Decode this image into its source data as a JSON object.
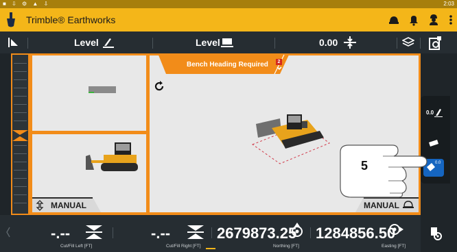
{
  "status_bar": {
    "time": "2:03",
    "icons": [
      "square-icon",
      "download-icon",
      "satellite-icon",
      "warning-icon",
      "download-icon"
    ]
  },
  "app": {
    "title": "Trimble® Earthworks"
  },
  "toolbar": {
    "left_mode": "Level",
    "center_mode": "Level",
    "offset_value": "0.00"
  },
  "alert": {
    "text": "Bench Heading Required",
    "count": "2"
  },
  "panes": {
    "bottom_left_label": "MANUAL",
    "main_label": "MANUAL"
  },
  "sidebar": {
    "items": [
      {
        "icon": "settings-panel-icon"
      },
      {
        "icon": "offset-icon",
        "text": "0.0"
      },
      {
        "icon": "blade-icon"
      },
      {
        "icon": "blade-offset-icon",
        "text": "0.0",
        "active": true
      }
    ]
  },
  "annotation": {
    "step": "5"
  },
  "bottom": {
    "items": [
      {
        "value": "-.--",
        "label": "Cut/Fill Left  [FT]"
      },
      {
        "value": "-.--",
        "label": "Cut/Fill Right  [FT]"
      },
      {
        "value": "2679873.25",
        "label": "Northing  [FT]"
      },
      {
        "value": "1284856.50",
        "label": "Easting  [FT]"
      }
    ]
  },
  "colors": {
    "accent": "#f4b619",
    "border": "#f28c19",
    "active": "#1565c0",
    "alert": "#d4291d"
  }
}
